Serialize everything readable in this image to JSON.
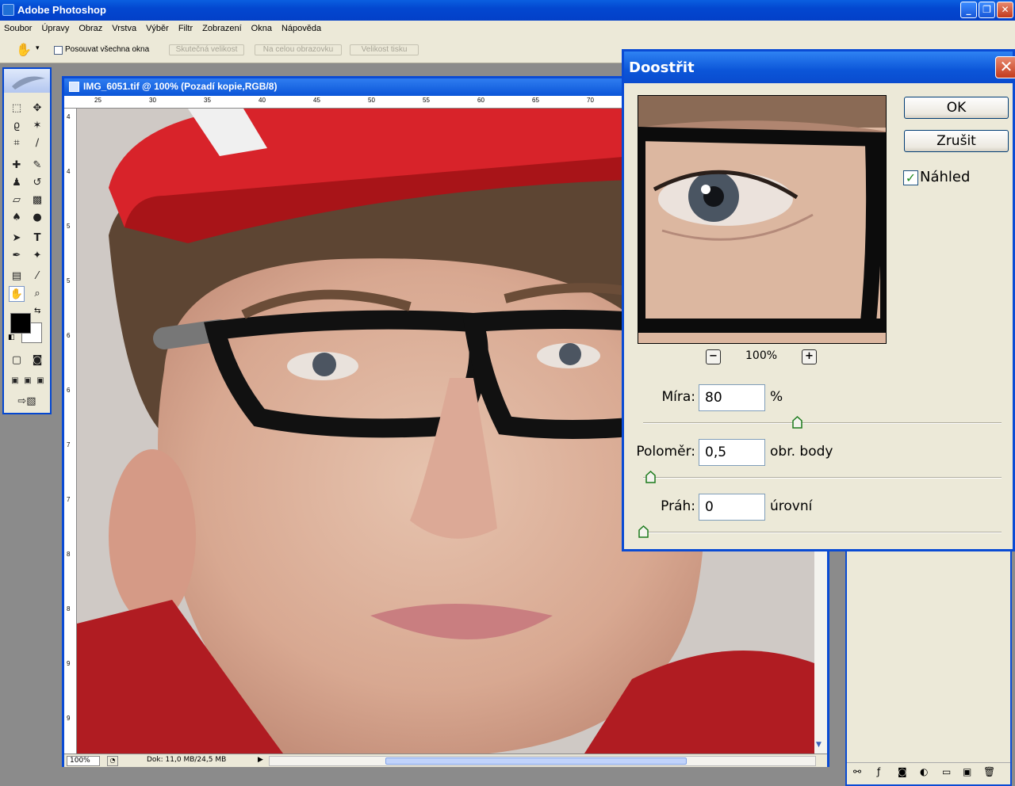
{
  "app": {
    "title": "Adobe Photoshop"
  },
  "menu": {
    "items": [
      "Soubor",
      "Úpravy",
      "Obraz",
      "Vrstva",
      "Výběr",
      "Filtr",
      "Zobrazení",
      "Okna",
      "Nápověda"
    ]
  },
  "options": {
    "scroll_all_label": "Posouvat všechna okna",
    "buttons": [
      "Skutečná velikost",
      "Na celou obrazovku",
      "Velikost tisku"
    ]
  },
  "document": {
    "title": "IMG_6051.tif @ 100% (Pozadí kopie,RGB/8)",
    "zoom": "100%",
    "info": "Dok: 11,0 MB/24,5 MB",
    "ruler_top": [
      "25",
      "30",
      "35",
      "40",
      "45",
      "50",
      "55",
      "60",
      "65",
      "70"
    ],
    "ruler_left": [
      "4",
      "4",
      "5",
      "5",
      "6",
      "6",
      "7",
      "7",
      "8",
      "8",
      "9",
      "9"
    ]
  },
  "dialog": {
    "title": "Doostřit",
    "ok": "OK",
    "cancel": "Zrušit",
    "preview_label": "Náhled",
    "preview_checked": true,
    "zoom_out": "−",
    "zoom_in": "+",
    "preview_zoom": "100%",
    "amount": {
      "label": "Míra:",
      "value": "80",
      "unit": "%",
      "slider_fraction": 0.43
    },
    "radius": {
      "label": "Poloměr:",
      "value": "0,5",
      "unit": "obr. body",
      "slider_fraction": 0.02
    },
    "threshold": {
      "label": "Práh:",
      "value": "0",
      "unit": "úrovní",
      "slider_fraction": 0.0
    }
  },
  "colors": {
    "accent": "#0a4bd4",
    "panel": "#ece9d8",
    "close_red": "#c33a1c",
    "check_green": "#218a21"
  },
  "icons": [
    "photoshop-icon",
    "minimize-icon",
    "maximize-icon",
    "close-icon",
    "hand-icon",
    "marquee-icon",
    "move-icon",
    "lasso-icon",
    "magic-wand-icon",
    "crop-icon",
    "slice-icon",
    "healing-brush-icon",
    "brush-icon",
    "stamp-icon",
    "history-brush-icon",
    "eraser-icon",
    "gradient-icon",
    "blur-icon",
    "dodge-icon",
    "path-select-icon",
    "type-icon",
    "pen-icon",
    "shape-icon",
    "notes-icon",
    "eyedropper-icon",
    "zoom-icon"
  ]
}
